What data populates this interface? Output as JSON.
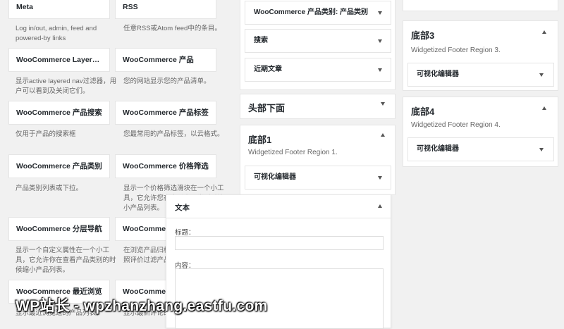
{
  "available_widgets": [
    {
      "label": "Meta",
      "desc": "Log in/out, admin, feed and powered-by links"
    },
    {
      "label": "RSS",
      "desc": "任意RSS或Atom feed中的条目。"
    },
    {
      "label": "WooCommerce Layered...",
      "desc": "显示active layered nav过滤器，用户可以看到及关闭它们。"
    },
    {
      "label": "WooCommerce 产品",
      "desc": "您的网站显示您的产品清单。"
    },
    {
      "label": "WooCommerce 产品搜索",
      "desc": "仅用于产品的搜索框"
    },
    {
      "label": "WooCommerce 产品标签",
      "desc": "您最常用的产品标签，以云格式。"
    },
    {
      "label": "WooCommerce 产品类别",
      "desc": "产品类别列表或下拉。"
    },
    {
      "label": "WooCommerce 价格筛选",
      "desc": "显示一个价格筛选滑块在一个小工具，它允许您在查看产品类别时缩小产品列表。"
    },
    {
      "label": "WooCommerce 分层导航",
      "desc": "显示一个自定义属性在一个小工具，它允许你在查看产品类别的时候缩小产品列表。"
    },
    {
      "label": "WooCommerce 推荐产品",
      "desc": "在浏览产品归档页面时显示一个按照评价过滤产品列表的小工具。"
    },
    {
      "label": "WooCommerce 最近浏览",
      "desc": "显示最近浏览过的产品列表。"
    },
    {
      "label": "WooCommerce 最新评论",
      "desc": "显示最新评论的产品列表。"
    }
  ],
  "middle_column": {
    "top_widgets": [
      "WooCommerce 产品类别: 产品类别",
      "搜索",
      "近期文章"
    ],
    "header_below": {
      "title": "头部下面"
    },
    "footer1": {
      "title": "底部1",
      "desc": "Widgetized Footer Region 1.",
      "widget": "可视化编辑器"
    }
  },
  "right_column": {
    "footer3": {
      "title": "底部3",
      "desc": "Widgetized Footer Region 3.",
      "widget": "可视化编辑器"
    },
    "footer4": {
      "title": "底部4",
      "desc": "Widgetized Footer Region 4.",
      "widget": "可视化编辑器"
    }
  },
  "text_widget_panel": {
    "title": "文本",
    "title_label": "标题：",
    "title_value": "",
    "content_label": "内容：",
    "content_value": ""
  },
  "watermark": "WP站长 - wpzhanzhang.eastfu.com"
}
